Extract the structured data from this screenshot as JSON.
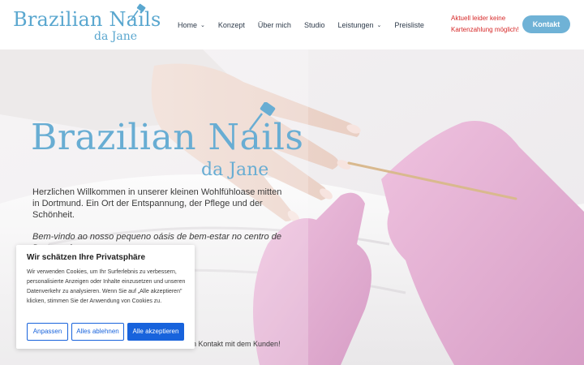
{
  "header": {
    "logo": {
      "main": "Brazilian Nails",
      "sub": "da Jane"
    },
    "nav": [
      {
        "label": "Home",
        "has_dropdown": true
      },
      {
        "label": "Konzept",
        "has_dropdown": false
      },
      {
        "label": "Über mich",
        "has_dropdown": false
      },
      {
        "label": "Studio",
        "has_dropdown": false
      },
      {
        "label": "Leistungen",
        "has_dropdown": true
      },
      {
        "label": "Preisliste",
        "has_dropdown": false
      }
    ],
    "notice": "Aktuell leider keine Kartenzahlung möglich!",
    "cta_label": "Kontakt"
  },
  "hero": {
    "logo": {
      "main": "Brazilian Nails",
      "sub": "da Jane"
    },
    "intro": "Herzlichen Willkommen in unserer kleinen Wohlfühloase mitten in Dortmund. Ein Ort der Entspannung, der Pflege und der Schönheit.",
    "intro_pt": "Bem-vindo ao nosso pequeno oásis de bem-estar no centro de Dortmund.",
    "bottom_text": "en Kontakt mit dem Kunden!"
  },
  "cookie": {
    "title": "Wir schätzen Ihre Privatsphäre",
    "text": "Wir verwenden Cookies, um Ihr Surferlebnis zu verbessern, personalisierte Anzeigen oder Inhalte einzusetzen und unseren Datenverkehr zu analysieren. Wenn Sie auf „Alle akzeptieren\" klicken, stimmen Sie der Anwendung von Cookies zu.",
    "buttons": {
      "customize": "Anpassen",
      "reject": "Alles ablehnen",
      "accept": "Alle akzeptieren"
    }
  },
  "colors": {
    "brand": "#5aa7cf",
    "cta": "#6fb2d6",
    "notice": "#d62828",
    "cookie_accent": "#1863dc"
  }
}
